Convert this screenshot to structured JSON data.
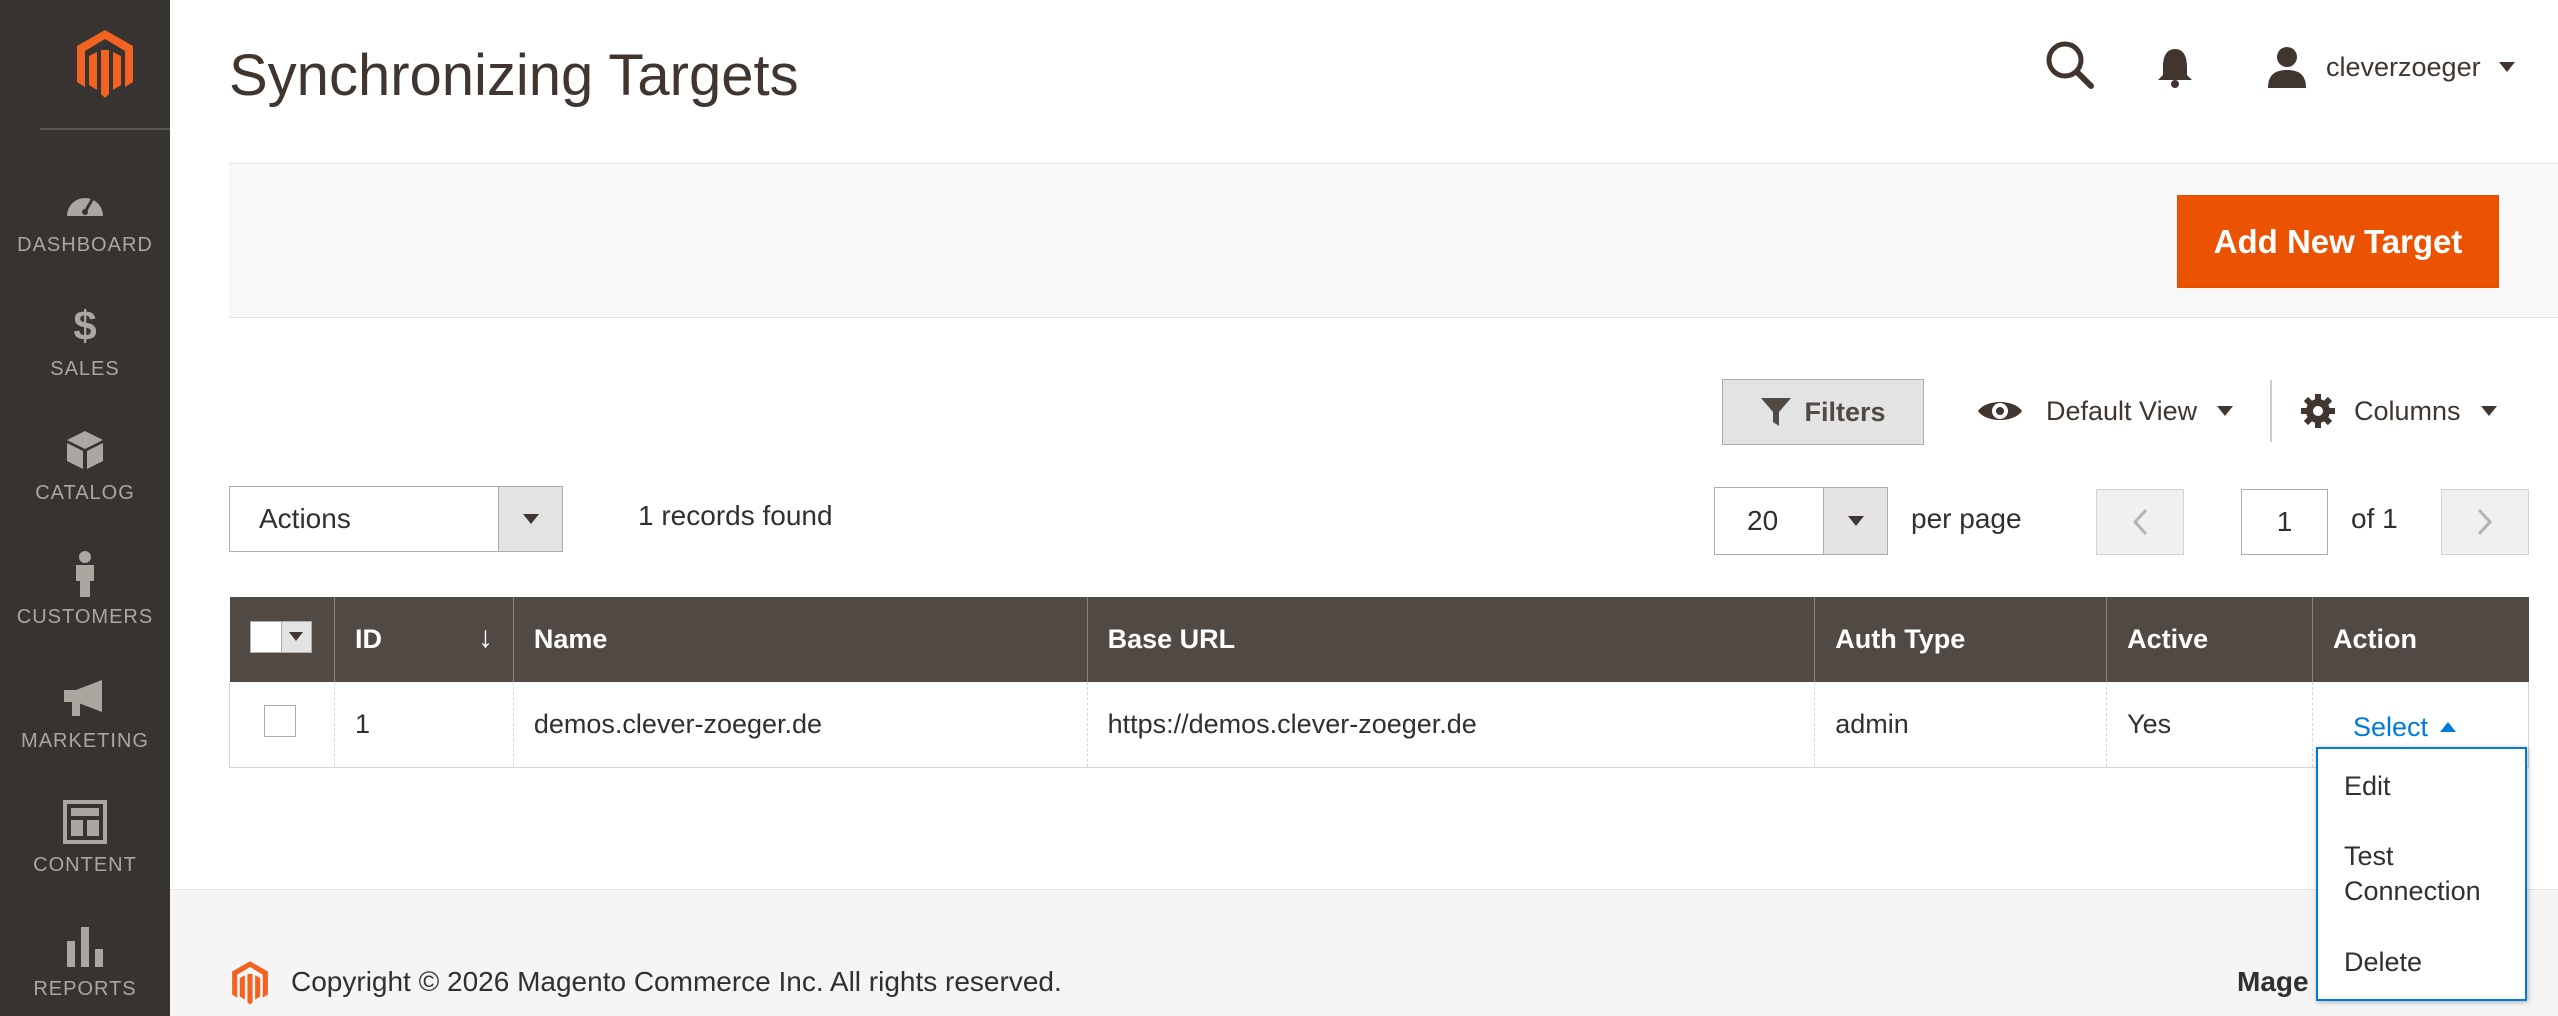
{
  "sidebar": {
    "items": [
      {
        "label": "DASHBOARD",
        "icon": "speedometer-icon"
      },
      {
        "label": "SALES",
        "icon": "dollar-icon"
      },
      {
        "label": "CATALOG",
        "icon": "box-icon"
      },
      {
        "label": "CUSTOMERS",
        "icon": "person-icon"
      },
      {
        "label": "MARKETING",
        "icon": "megaphone-icon"
      },
      {
        "label": "CONTENT",
        "icon": "layout-icon"
      },
      {
        "label": "REPORTS",
        "icon": "bar-chart-icon"
      }
    ]
  },
  "header": {
    "title": "Synchronizing Targets",
    "username": "cleverzoeger"
  },
  "page_actions": {
    "add_label": "Add New Target"
  },
  "toolbar": {
    "filters_label": "Filters",
    "view_label": "Default View",
    "columns_label": "Columns",
    "actions_label": "Actions",
    "records_found": "1 records found",
    "per_page_value": "20",
    "per_page_label": "per page",
    "current_page": "1",
    "page_of": "of 1"
  },
  "grid": {
    "columns": [
      "ID",
      "Name",
      "Base URL",
      "Auth Type",
      "Active",
      "Action"
    ],
    "rows": [
      {
        "id": "1",
        "name": "demos.clever-zoeger.de",
        "base_url": "https://demos.clever-zoeger.de",
        "auth_type": "admin",
        "active": "Yes",
        "action": "Select"
      }
    ]
  },
  "action_menu": {
    "items": [
      "Edit",
      "Test Connection",
      "Delete"
    ]
  },
  "footer": {
    "copyright": "Copyright © 2026 Magento Commerce Inc. All rights reserved.",
    "brand": "Mage"
  },
  "colors": {
    "sidebar_bg": "#373330",
    "accent": "#eb5202",
    "grid_header": "#514943",
    "link": "#007bdb"
  }
}
